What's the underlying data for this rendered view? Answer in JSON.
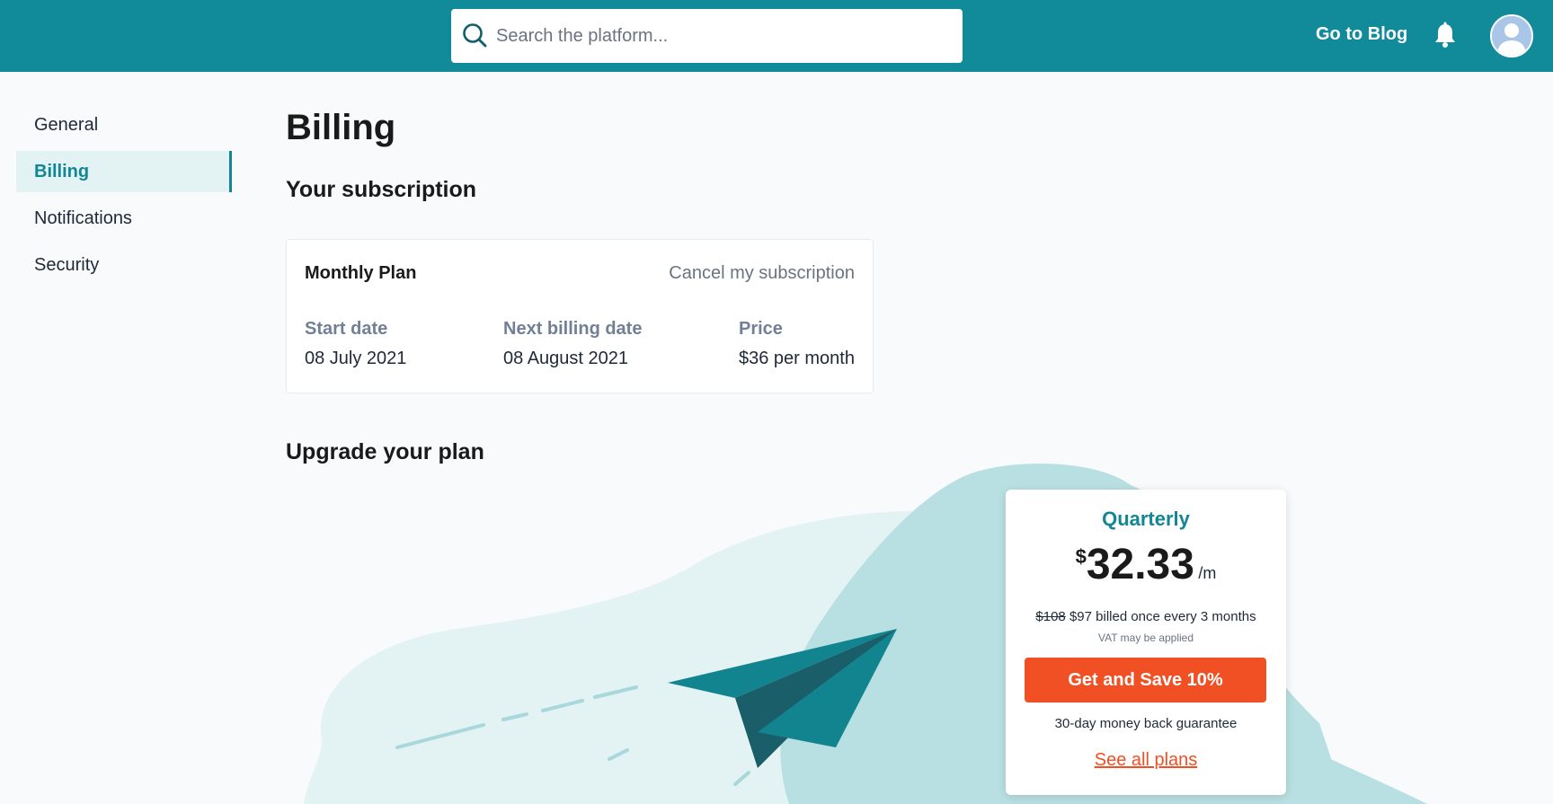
{
  "header": {
    "search_placeholder": "Search the platform...",
    "blog_link": "Go to Blog"
  },
  "sidebar": {
    "items": [
      {
        "label": "General"
      },
      {
        "label": "Billing",
        "active": true
      },
      {
        "label": "Notifications"
      },
      {
        "label": "Security"
      }
    ]
  },
  "main": {
    "title": "Billing",
    "subscription_heading": "Your subscription",
    "upgrade_heading": "Upgrade your plan"
  },
  "subscription": {
    "plan_name": "Monthly Plan",
    "cancel_label": "Cancel my subscription",
    "start_date_label": "Start date",
    "start_date": "08 July 2021",
    "next_billing_label": "Next billing date",
    "next_billing": "08 August 2021",
    "price_label": "Price",
    "price": "$36 per month"
  },
  "upgrade_card": {
    "name": "Quarterly",
    "currency": "$",
    "amount": "32.33",
    "per": "/m",
    "old_price": "$108",
    "billed": " $97 billed once every 3 months",
    "vat": "VAT may be applied",
    "button_label": "Get and Save 10%",
    "guarantee": "30-day money back guarantee",
    "see_all": "See all plans"
  },
  "colors": {
    "header_bg": "#118a9a",
    "accent": "#138696",
    "cta": "#f15024"
  }
}
